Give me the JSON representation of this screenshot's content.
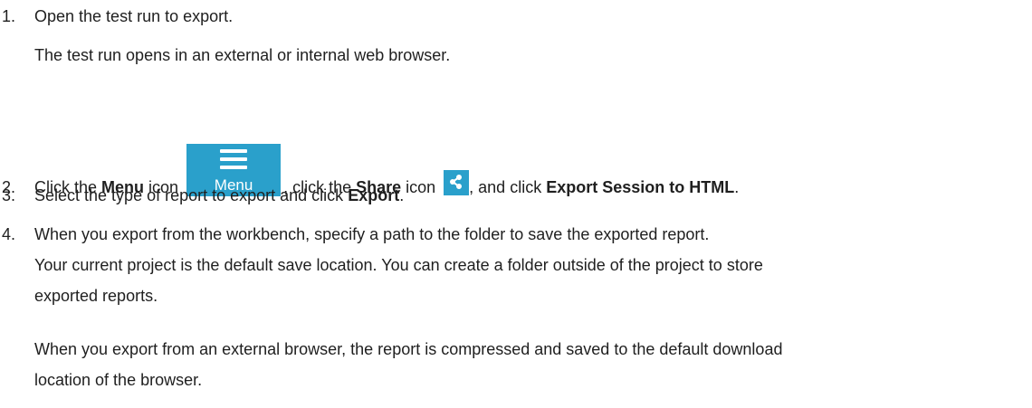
{
  "steps": [
    {
      "number": "1.",
      "text": "Open the test run to export.",
      "result": "The test run opens in an external or internal web browser."
    },
    {
      "number": "2.",
      "part1": "Click the ",
      "bold1": "Menu",
      "part2": " icon ",
      "menu_icon_label": "Menu",
      "part3": ", click the ",
      "bold2": "Share",
      "part4": " icon ",
      "part5": ", and click ",
      "bold3": "Export Session to HTML",
      "part6": "."
    },
    {
      "number": "3.",
      "part1": "Select the type of report to export and click ",
      "bold1": "Export",
      "part2": "."
    },
    {
      "number": "4.",
      "text": "When you export from the workbench, specify a path to the folder to save the exported report.",
      "note1_line1": "Your current project is the default save location. You can create a folder outside of the project to store",
      "note1_line2": "exported reports.",
      "note2_line1": "When you export from an external browser, the report is compressed and saved to the default download",
      "note2_line2": "location of the browser."
    }
  ],
  "colors": {
    "icon_background": "#2aa0cb",
    "icon_foreground": "#ffffff",
    "text": "#1f1f1f"
  },
  "icons": {
    "menu": "hamburger-menu-icon",
    "share": "share-icon"
  }
}
